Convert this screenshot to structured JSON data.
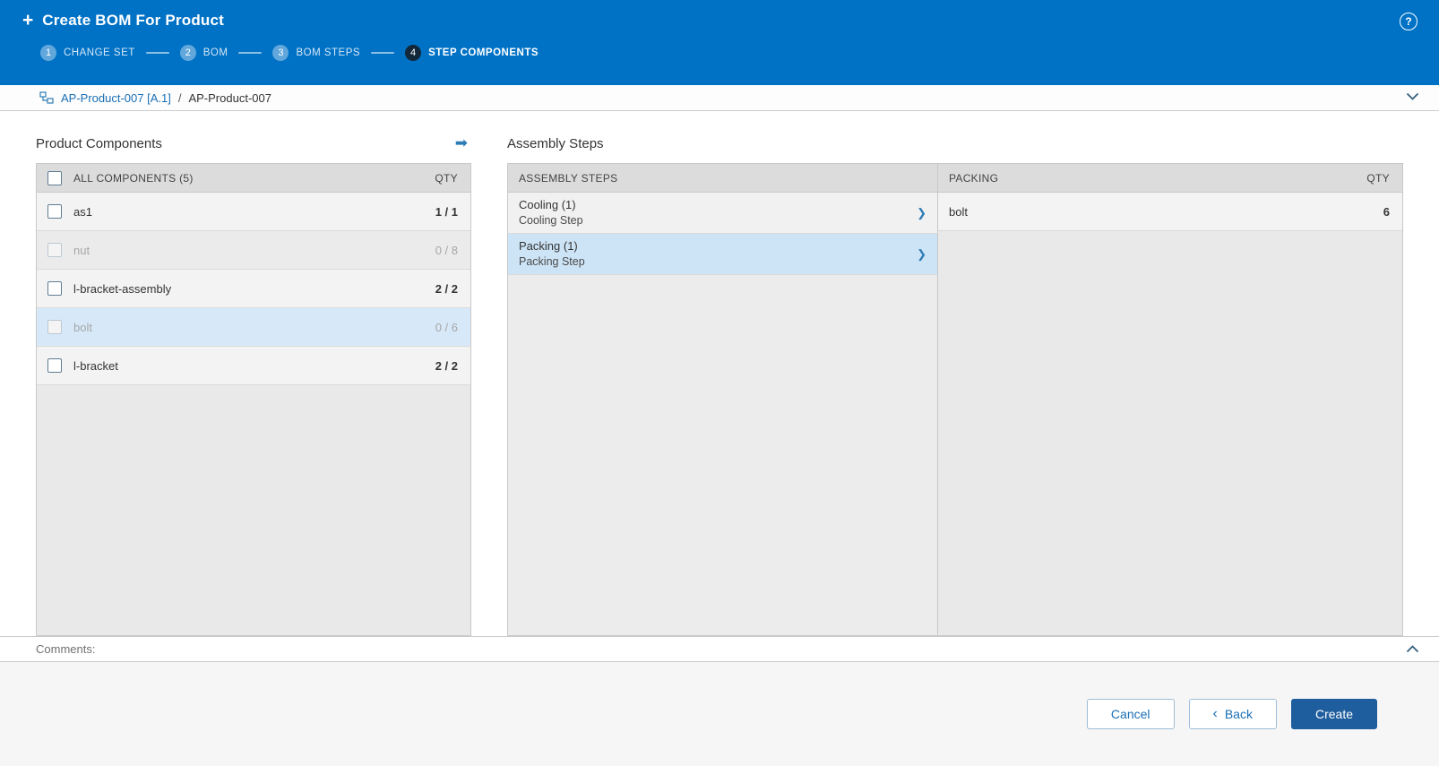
{
  "header": {
    "title": "Create BOM For Product",
    "steps": [
      {
        "num": "1",
        "label": "CHANGE SET",
        "active": false
      },
      {
        "num": "2",
        "label": "BOM",
        "active": false
      },
      {
        "num": "3",
        "label": "BOM STEPS",
        "active": false
      },
      {
        "num": "4",
        "label": "STEP COMPONENTS",
        "active": true
      }
    ]
  },
  "breadcrumb": {
    "link": "AP-Product-007 [A.1]",
    "separator": "/",
    "current": "AP-Product-007"
  },
  "components_panel": {
    "title": "Product Components",
    "header": {
      "label": "ALL COMPONENTS (5)",
      "qty": "QTY"
    },
    "rows": [
      {
        "name": "as1",
        "qty": "1 / 1",
        "disabled": false,
        "selected": false
      },
      {
        "name": "nut",
        "qty": "0 / 8",
        "disabled": true,
        "selected": false
      },
      {
        "name": "l-bracket-assembly",
        "qty": "2 / 2",
        "disabled": false,
        "selected": false
      },
      {
        "name": "bolt",
        "qty": "0 / 6",
        "disabled": true,
        "selected": true
      },
      {
        "name": "l-bracket",
        "qty": "2 / 2",
        "disabled": false,
        "selected": false
      }
    ]
  },
  "steps_panel": {
    "title": "Assembly Steps",
    "left_header": "ASSEMBLY STEPS",
    "steps": [
      {
        "title": "Cooling (1)",
        "subtitle": "Cooling Step",
        "selected": false
      },
      {
        "title": "Packing (1)",
        "subtitle": "Packing Step",
        "selected": true
      }
    ],
    "right_header": {
      "label": "PACKING",
      "qty": "QTY"
    },
    "rows": [
      {
        "name": "bolt",
        "qty": "6"
      }
    ]
  },
  "comments": {
    "label": "Comments:"
  },
  "footer": {
    "cancel_label": "Cancel",
    "back_label": "Back",
    "create_label": "Create"
  },
  "icons": {
    "plus": "+",
    "help": "?",
    "arrow": "➡",
    "chevron_right": "❯",
    "back_chevron": "‹"
  },
  "colors": {
    "header_blue": "#0072c6",
    "accent_link": "#1a6fb5",
    "selected_row": "#cde4f7",
    "primary_button": "#1e5d9e",
    "table_header": "#dcdcdc"
  }
}
